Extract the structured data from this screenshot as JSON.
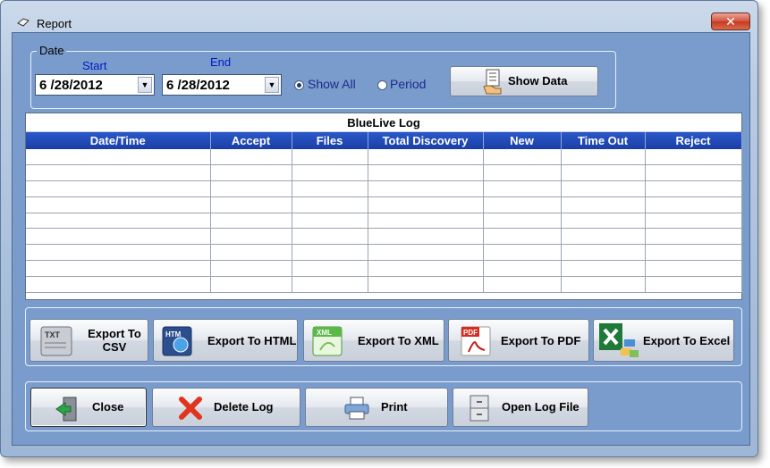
{
  "window": {
    "title": "Report",
    "close_glyph": "✕"
  },
  "date_group": {
    "legend": "Date",
    "start_label": "Start",
    "end_label": "End",
    "start_value": "6 /28/2012",
    "end_value": "6 /28/2012",
    "radio_show_all": "Show All",
    "radio_period": "Period",
    "selected_radio": "Show All",
    "show_data_label": "Show Data"
  },
  "grid": {
    "title": "BlueLive Log",
    "columns": [
      "Date/Time",
      "Accept",
      "Files",
      "Total Discovery",
      "New",
      "Time Out",
      "Reject"
    ],
    "row_count": 9
  },
  "export_buttons": [
    {
      "label": "Export To CSV",
      "icon": "txt-file-icon"
    },
    {
      "label": "Export To HTML",
      "icon": "html-file-icon"
    },
    {
      "label": "Export To XML",
      "icon": "xml-file-icon"
    },
    {
      "label": "Export To PDF",
      "icon": "pdf-file-icon"
    },
    {
      "label": "Export To Excel",
      "icon": "excel-icon"
    }
  ],
  "action_buttons": [
    {
      "label": "Close",
      "icon": "exit-door-icon"
    },
    {
      "label": "Delete Log",
      "icon": "red-x-icon"
    },
    {
      "label": "Print",
      "icon": "printer-icon"
    },
    {
      "label": "Open Log File",
      "icon": "file-cabinet-icon"
    }
  ],
  "icon_texts": {
    "txt": "TXT",
    "htm": "HTM",
    "xml": "XML",
    "pdf": "PDF"
  }
}
